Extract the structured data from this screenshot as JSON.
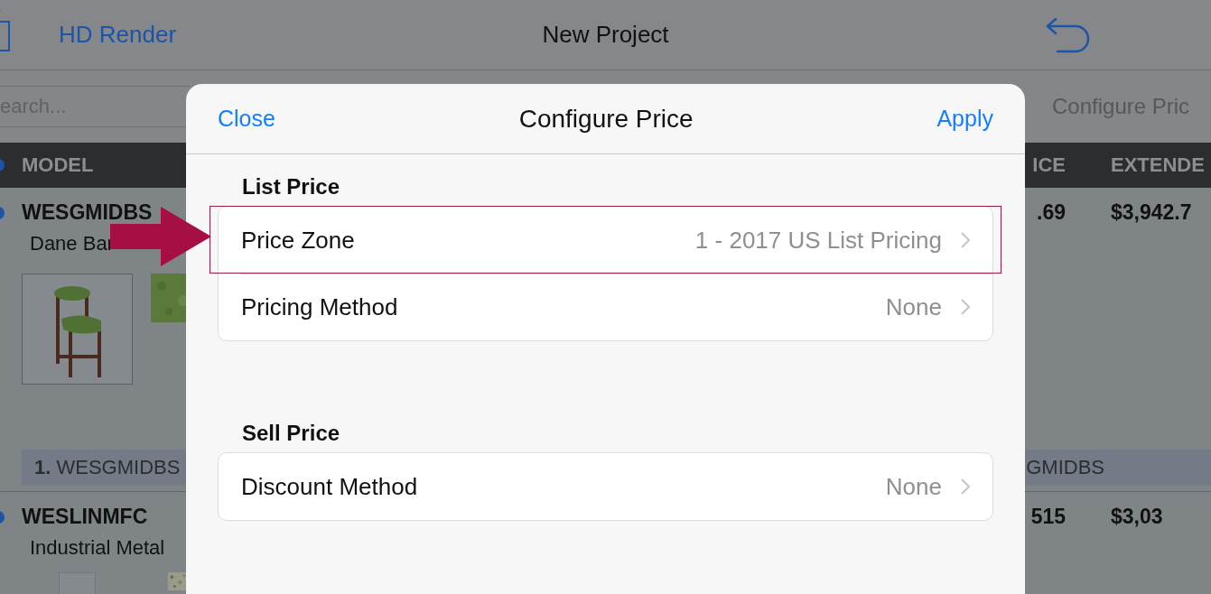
{
  "app_bar": {
    "left_button": "HD Render",
    "title": "New Project"
  },
  "search": {
    "placeholder": "earch..."
  },
  "side_label": "Configure Pric",
  "table": {
    "columns": [
      "MODEL",
      "ICE",
      "EXTENDE"
    ],
    "rows": [
      {
        "model": "WESGMIDBS",
        "description": "Dane Bar",
        "price": ".69",
        "extended": "$3,942.7",
        "group_label": "**1.** WESGMIDBS",
        "group_label_right": "GMIDBS"
      },
      {
        "model": "WESLINMFC",
        "description": "Industrial Metal",
        "price": "515",
        "extended": "$3,03"
      }
    ]
  },
  "modal": {
    "close": "Close",
    "title": "Configure Price",
    "apply": "Apply",
    "sections": [
      {
        "header": "List Price",
        "rows": [
          {
            "label": "Price Zone",
            "value": "1 - 2017 US List Pricing",
            "highlighted": true
          },
          {
            "label": "Pricing Method",
            "value": "None",
            "highlighted": false
          }
        ]
      },
      {
        "header": "Sell Price",
        "rows": [
          {
            "label": "Discount Method",
            "value": "None",
            "highlighted": false
          }
        ]
      }
    ]
  }
}
